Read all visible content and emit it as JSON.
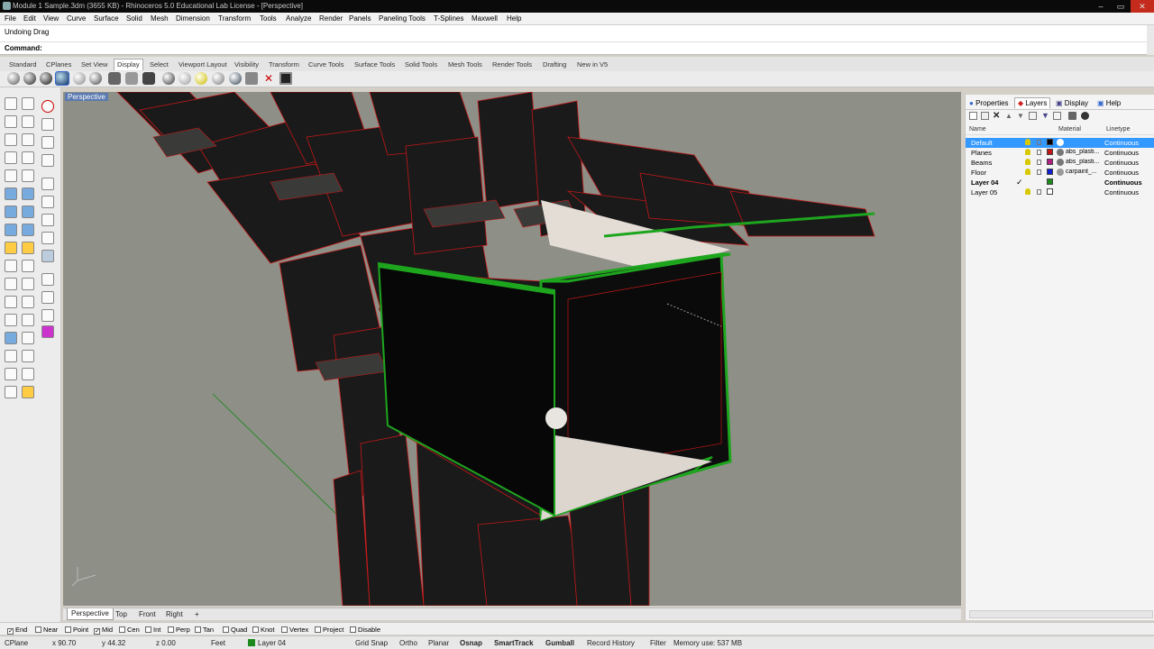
{
  "window": {
    "title": "Module 1 Sample.3dm (3655 KB) - Rhinoceros 5.0 Educational Lab License - [Perspective]",
    "min": "–",
    "max": "▭",
    "close": "✕"
  },
  "menu": [
    "File",
    "Edit",
    "View",
    "Curve",
    "Surface",
    "Solid",
    "Mesh",
    "Dimension",
    "Transform",
    "Tools",
    "Analyze",
    "Render",
    "Panels",
    "Paneling Tools",
    "T-Splines",
    "Maxwell",
    "Help"
  ],
  "command": {
    "history": "Undoing Drag",
    "label": "Command:",
    "value": ""
  },
  "toolbar_tabs": [
    "Standard",
    "CPlanes",
    "Set View",
    "Display",
    "Select",
    "Viewport Layout",
    "Visibility",
    "Transform",
    "Curve Tools",
    "Surface Tools",
    "Solid Tools",
    "Mesh Tools",
    "Render Tools",
    "Drafting",
    "New in V5"
  ],
  "active_toolbar_tab": "Display",
  "viewport": {
    "label": "Perspective",
    "tabs": [
      "Perspective",
      "Top",
      "Front",
      "Right"
    ],
    "add_tab": "+"
  },
  "panel": {
    "tabs": [
      "Properties",
      "Layers",
      "Display",
      "Help"
    ],
    "active_tab": "Layers",
    "headers": {
      "name": "Name",
      "material": "Material",
      "linetype": "Linetype"
    },
    "layers": [
      {
        "name": "Default",
        "material": "",
        "linetype": "Continuous",
        "color": "#000000",
        "mat_color": "#ffffff",
        "selected": true,
        "current": false
      },
      {
        "name": "Planes",
        "material": "abs_plasti...",
        "linetype": "Continuous",
        "color": "#c01818",
        "mat_color": "#777777",
        "selected": false,
        "current": false
      },
      {
        "name": "Beams",
        "material": "abs_plasti...",
        "linetype": "Continuous",
        "color": "#b02080",
        "mat_color": "#777777",
        "selected": false,
        "current": false
      },
      {
        "name": "Floor",
        "material": "carpaint_...",
        "linetype": "Continuous",
        "color": "#1020d0",
        "mat_color": "#999999",
        "selected": false,
        "current": false
      },
      {
        "name": "Layer 04",
        "material": "",
        "linetype": "Continuous",
        "color": "#1c8a1c",
        "mat_color": "",
        "selected": false,
        "current": true
      },
      {
        "name": "Layer 05",
        "material": "",
        "linetype": "Continuous",
        "color": "#ffffff",
        "mat_color": "",
        "selected": false,
        "current": false
      }
    ]
  },
  "osnap": [
    {
      "label": "End",
      "checked": true
    },
    {
      "label": "Near",
      "checked": false
    },
    {
      "label": "Point",
      "checked": false
    },
    {
      "label": "Mid",
      "checked": true
    },
    {
      "label": "Cen",
      "checked": false
    },
    {
      "label": "Int",
      "checked": false
    },
    {
      "label": "Perp",
      "checked": false
    },
    {
      "label": "Tan",
      "checked": false
    },
    {
      "label": "Quad",
      "checked": false
    },
    {
      "label": "Knot",
      "checked": false
    },
    {
      "label": "Vertex",
      "checked": false
    },
    {
      "label": "Project",
      "checked": false
    },
    {
      "label": "Disable",
      "checked": false
    }
  ],
  "status": {
    "cplane": "CPlane",
    "x": "x 90.70",
    "y": "y 44.32",
    "z": "z 0.00",
    "units": "Feet",
    "layer": "Layer 04",
    "toggles": [
      "Grid Snap",
      "Ortho",
      "Planar",
      "Osnap",
      "SmartTrack",
      "Gumball",
      "Record History",
      "Filter"
    ],
    "memory": "Memory use: 537 MB"
  },
  "colors": {
    "accent": "#3399ff",
    "edge_red": "#c41818",
    "edge_green": "#1ea51e",
    "viewport_bg": "#8e8f87"
  }
}
